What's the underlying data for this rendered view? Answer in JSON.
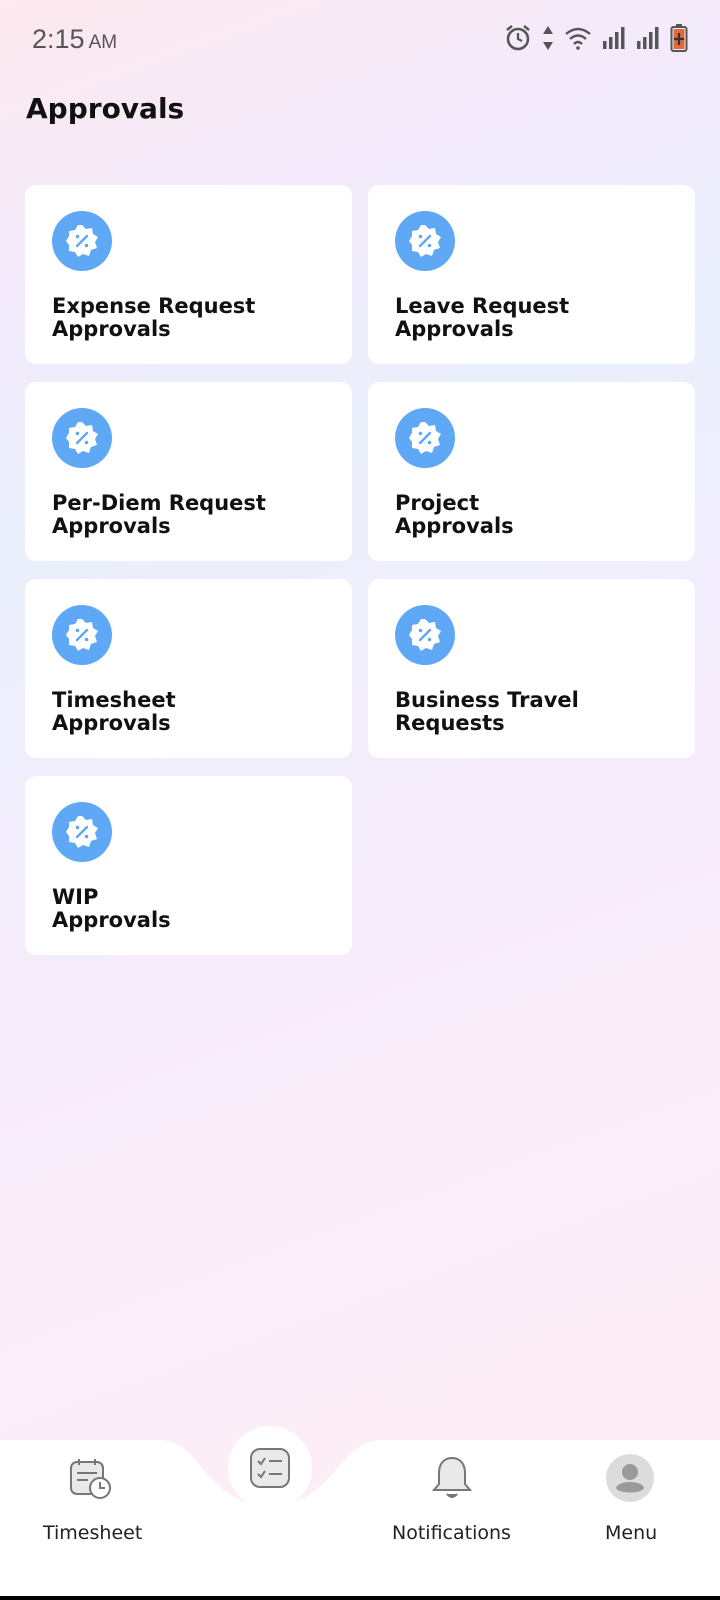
{
  "status_bar": {
    "time": "2:15",
    "ampm": "AM"
  },
  "header": {
    "title": "Approvals"
  },
  "cards": [
    {
      "line1": "Expense Request",
      "line2": "Approvals"
    },
    {
      "line1": "Leave Request",
      "line2": "Approvals"
    },
    {
      "line1": "Per-Diem Request",
      "line2": "Approvals"
    },
    {
      "line1": "Project",
      "line2": "Approvals"
    },
    {
      "line1": "Timesheet",
      "line2": "Approvals"
    },
    {
      "line1": "Business Travel",
      "line2": "Requests"
    },
    {
      "line1": "WIP",
      "line2": "Approvals"
    }
  ],
  "bottom_nav": {
    "timesheet": "Timesheet",
    "notifications": "Notifications",
    "menu": "Menu"
  },
  "colors": {
    "badge": "#5fa8f5",
    "nav_bg": "#ffffff"
  }
}
